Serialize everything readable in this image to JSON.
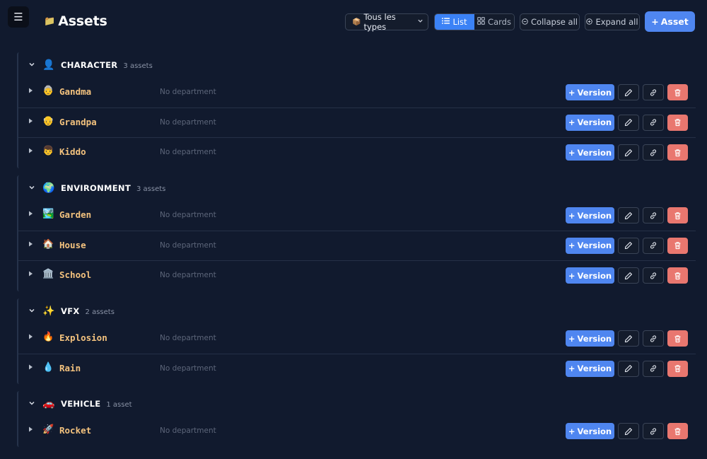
{
  "header": {
    "menu_icon": "☰",
    "title_icon": "📁",
    "title": "Assets",
    "type_filter": {
      "icon": "📦",
      "value": "Tous les types"
    },
    "view_toggle": {
      "list_label": "List",
      "cards_label": "Cards",
      "active": "list"
    },
    "collapse_all_label": "Collapse all",
    "expand_all_label": "Expand all",
    "add_asset_label": "Asset"
  },
  "row_actions": {
    "version_label": "Version"
  },
  "groups": [
    {
      "icon": "👤",
      "name": "CHARACTER",
      "count": "3 assets",
      "assets": [
        {
          "icon": "👵",
          "name": "Gandma",
          "department": "No department"
        },
        {
          "icon": "👴",
          "name": "Grandpa",
          "department": "No department"
        },
        {
          "icon": "👦",
          "name": "Kiddo",
          "department": "No department"
        }
      ]
    },
    {
      "icon": "🌍",
      "name": "ENVIRONMENT",
      "count": "3 assets",
      "assets": [
        {
          "icon": "🏞️",
          "name": "Garden",
          "department": "No department"
        },
        {
          "icon": "🏠",
          "name": "House",
          "department": "No department"
        },
        {
          "icon": "🏛️",
          "name": "School",
          "department": "No department"
        }
      ]
    },
    {
      "icon": "✨",
      "name": "VFX",
      "count": "2 assets",
      "assets": [
        {
          "icon": "🔥",
          "name": "Explosion",
          "department": "No department"
        },
        {
          "icon": "💧",
          "name": "Rain",
          "department": "No department"
        }
      ]
    },
    {
      "icon": "🚗",
      "name": "VEHICLE",
      "count": "1 asset",
      "assets": [
        {
          "icon": "🚀",
          "name": "Rocket",
          "department": "No department"
        }
      ]
    }
  ]
}
